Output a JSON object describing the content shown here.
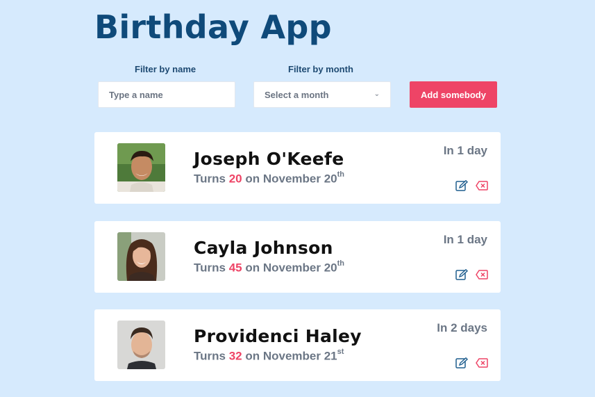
{
  "app": {
    "title": "Birthday App"
  },
  "filters": {
    "name_label": "Filter by name",
    "name_placeholder": "Type a name",
    "month_label": "Filter by month",
    "month_selected": "Select a month",
    "add_button": "Add somebody"
  },
  "colors": {
    "background": "#d6eafd",
    "title": "#0f4a7a",
    "accent": "#ee4466",
    "muted": "#6b7685"
  },
  "people": [
    {
      "name": "Joseph O'Keefe",
      "turns_prefix": "Turns",
      "age": "20",
      "on_text": "on November 20",
      "suffix": "th",
      "when": "In 1 day",
      "avatar": "avatar-photo"
    },
    {
      "name": "Cayla Johnson",
      "turns_prefix": "Turns",
      "age": "45",
      "on_text": "on November 20",
      "suffix": "th",
      "when": "In 1 day",
      "avatar": "avatar-photo"
    },
    {
      "name": "Providenci Haley",
      "turns_prefix": "Turns",
      "age": "32",
      "on_text": "on November 21",
      "suffix": "st",
      "when": "In 2 days",
      "avatar": "avatar-photo"
    }
  ],
  "icons": {
    "edit": "edit-icon",
    "delete": "backspace-delete-icon",
    "chevron": "chevron-down-icon"
  }
}
